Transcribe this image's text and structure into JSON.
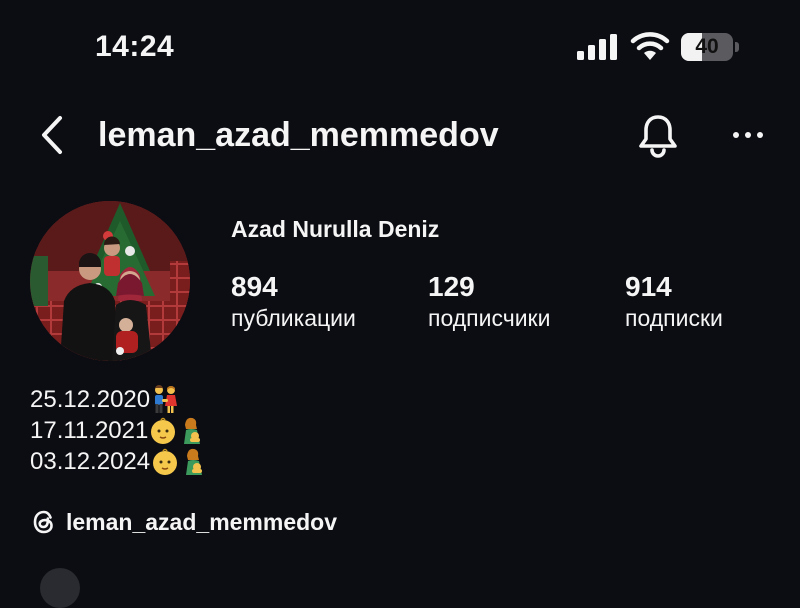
{
  "status_bar": {
    "time": "14:24",
    "battery_level": "40",
    "battery_fraction": 0.4
  },
  "header": {
    "username": "leman_azad_memmedov",
    "icons": [
      "back-chevron-icon",
      "bell-icon",
      "more-horizontal-icon"
    ]
  },
  "profile": {
    "display_name": "Azad Nurulla Deniz",
    "stats": [
      {
        "value": "894",
        "label": "публикации"
      },
      {
        "value": "129",
        "label": "подписчики"
      },
      {
        "value": "914",
        "label": "подписки"
      }
    ],
    "bio": [
      {
        "text": "25.12.2020",
        "emojis": [
          "couple-holding-hands-emoji"
        ]
      },
      {
        "text": "17.11.2021",
        "emojis": [
          "baby-face-emoji",
          "breastfeeding-woman-emoji"
        ]
      },
      {
        "text": "03.12.2024",
        "emojis": [
          "baby-face-emoji",
          "breastfeeding-woman-emoji"
        ]
      }
    ],
    "threads_handle": "leman_azad_memmedov"
  },
  "colors": {
    "background": "#0c0d13",
    "text": "#f5f5f5"
  }
}
